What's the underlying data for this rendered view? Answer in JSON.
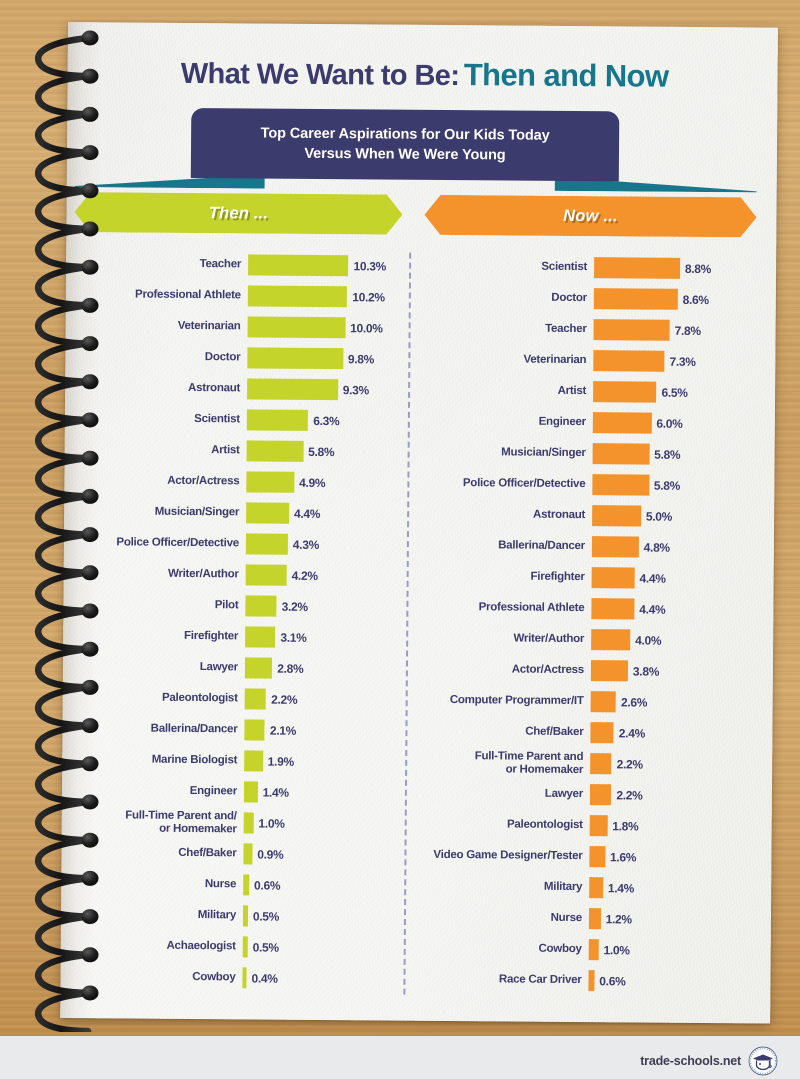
{
  "title": {
    "part1": "What We Want to Be:",
    "part2": "Then and Now"
  },
  "banner": {
    "line1": "Top Career Aspirations for Our Kids Today",
    "line2": "Versus When We Were Young"
  },
  "columns": {
    "then": {
      "header": "Then ...",
      "color": "#c4d42a"
    },
    "now": {
      "header": "Now ...",
      "color": "#f4922c"
    }
  },
  "footer": {
    "text": "trade-schools.net",
    "logo_icon": "graduation-cap-icon"
  },
  "colors": {
    "title_dark": "#3c3b6e",
    "title_teal": "#17768c",
    "banner_purple": "#3c3b6e",
    "ribbon_teal": "#17768c",
    "green": "#c4d42a",
    "orange": "#f4922c",
    "paper": "#f5f5f2",
    "wood": "#cfa264",
    "footer_band": "#e9eaec"
  },
  "chart_data": [
    {
      "type": "bar",
      "title": "Then ...",
      "orientation": "horizontal",
      "xlabel": "",
      "ylabel": "",
      "unit": "%",
      "grid": false,
      "legend": "none",
      "xlim": [
        0,
        10.3
      ],
      "categories": [
        "Teacher",
        "Professional Athlete",
        "Veterinarian",
        "Doctor",
        "Astronaut",
        "Scientist",
        "Artist",
        "Actor/Actress",
        "Musician/Singer",
        "Police Officer/Detective",
        "Writer/Author",
        "Pilot",
        "Firefighter",
        "Lawyer",
        "Paleontologist",
        "Ballerina/Dancer",
        "Marine Biologist",
        "Engineer",
        "Full-Time Parent and/\nor Homemaker",
        "Chef/Baker",
        "Nurse",
        "Military",
        "Achaeologist",
        "Cowboy"
      ],
      "values": [
        10.3,
        10.2,
        10.0,
        9.8,
        9.3,
        6.3,
        5.8,
        4.9,
        4.4,
        4.3,
        4.2,
        3.2,
        3.1,
        2.8,
        2.2,
        2.1,
        1.9,
        1.4,
        1.0,
        0.9,
        0.6,
        0.5,
        0.5,
        0.4
      ],
      "labels": [
        "10.3%",
        "10.2%",
        "10.0%",
        "9.8%",
        "9.3%",
        "6.3%",
        "5.8%",
        "4.9%",
        "4.4%",
        "4.3%",
        "4.2%",
        "3.2%",
        "3.1%",
        "2.8%",
        "2.2%",
        "2.1%",
        "1.9%",
        "1.4%",
        "1.0%",
        "0.9%",
        "0.6%",
        "0.5%",
        "0.5%",
        "0.4%"
      ]
    },
    {
      "type": "bar",
      "title": "Now ...",
      "orientation": "horizontal",
      "xlabel": "",
      "ylabel": "",
      "unit": "%",
      "grid": false,
      "legend": "none",
      "xlim": [
        0,
        8.8
      ],
      "categories": [
        "Scientist",
        "Doctor",
        "Teacher",
        "Veterinarian",
        "Artist",
        "Engineer",
        "Musician/Singer",
        "Police Officer/Detective",
        "Astronaut",
        "Ballerina/Dancer",
        "Firefighter",
        "Professional Athlete",
        "Writer/Author",
        "Actor/Actress",
        "Computer Programmer/IT",
        "Chef/Baker",
        "Full-Time Parent and\nor Homemaker",
        "Lawyer",
        "Paleontologist",
        "Video Game Designer/Tester",
        "Military",
        "Nurse",
        "Cowboy",
        "Race Car Driver"
      ],
      "values": [
        8.8,
        8.6,
        7.8,
        7.3,
        6.5,
        6.0,
        5.8,
        5.8,
        5.0,
        4.8,
        4.4,
        4.4,
        4.0,
        3.8,
        2.6,
        2.4,
        2.2,
        2.2,
        1.8,
        1.6,
        1.4,
        1.2,
        1.0,
        0.6
      ],
      "labels": [
        "8.8%",
        "8.6%",
        "7.8%",
        "7.3%",
        "6.5%",
        "6.0%",
        "5.8%",
        "5.8%",
        "5.0%",
        "4.8%",
        "4.4%",
        "4.4%",
        "4.0%",
        "3.8%",
        "2.6%",
        "2.4%",
        "2.2%",
        "2.2%",
        "1.8%",
        "1.6%",
        "1.4%",
        "1.2%",
        "1.0%",
        "0.6%"
      ]
    }
  ]
}
